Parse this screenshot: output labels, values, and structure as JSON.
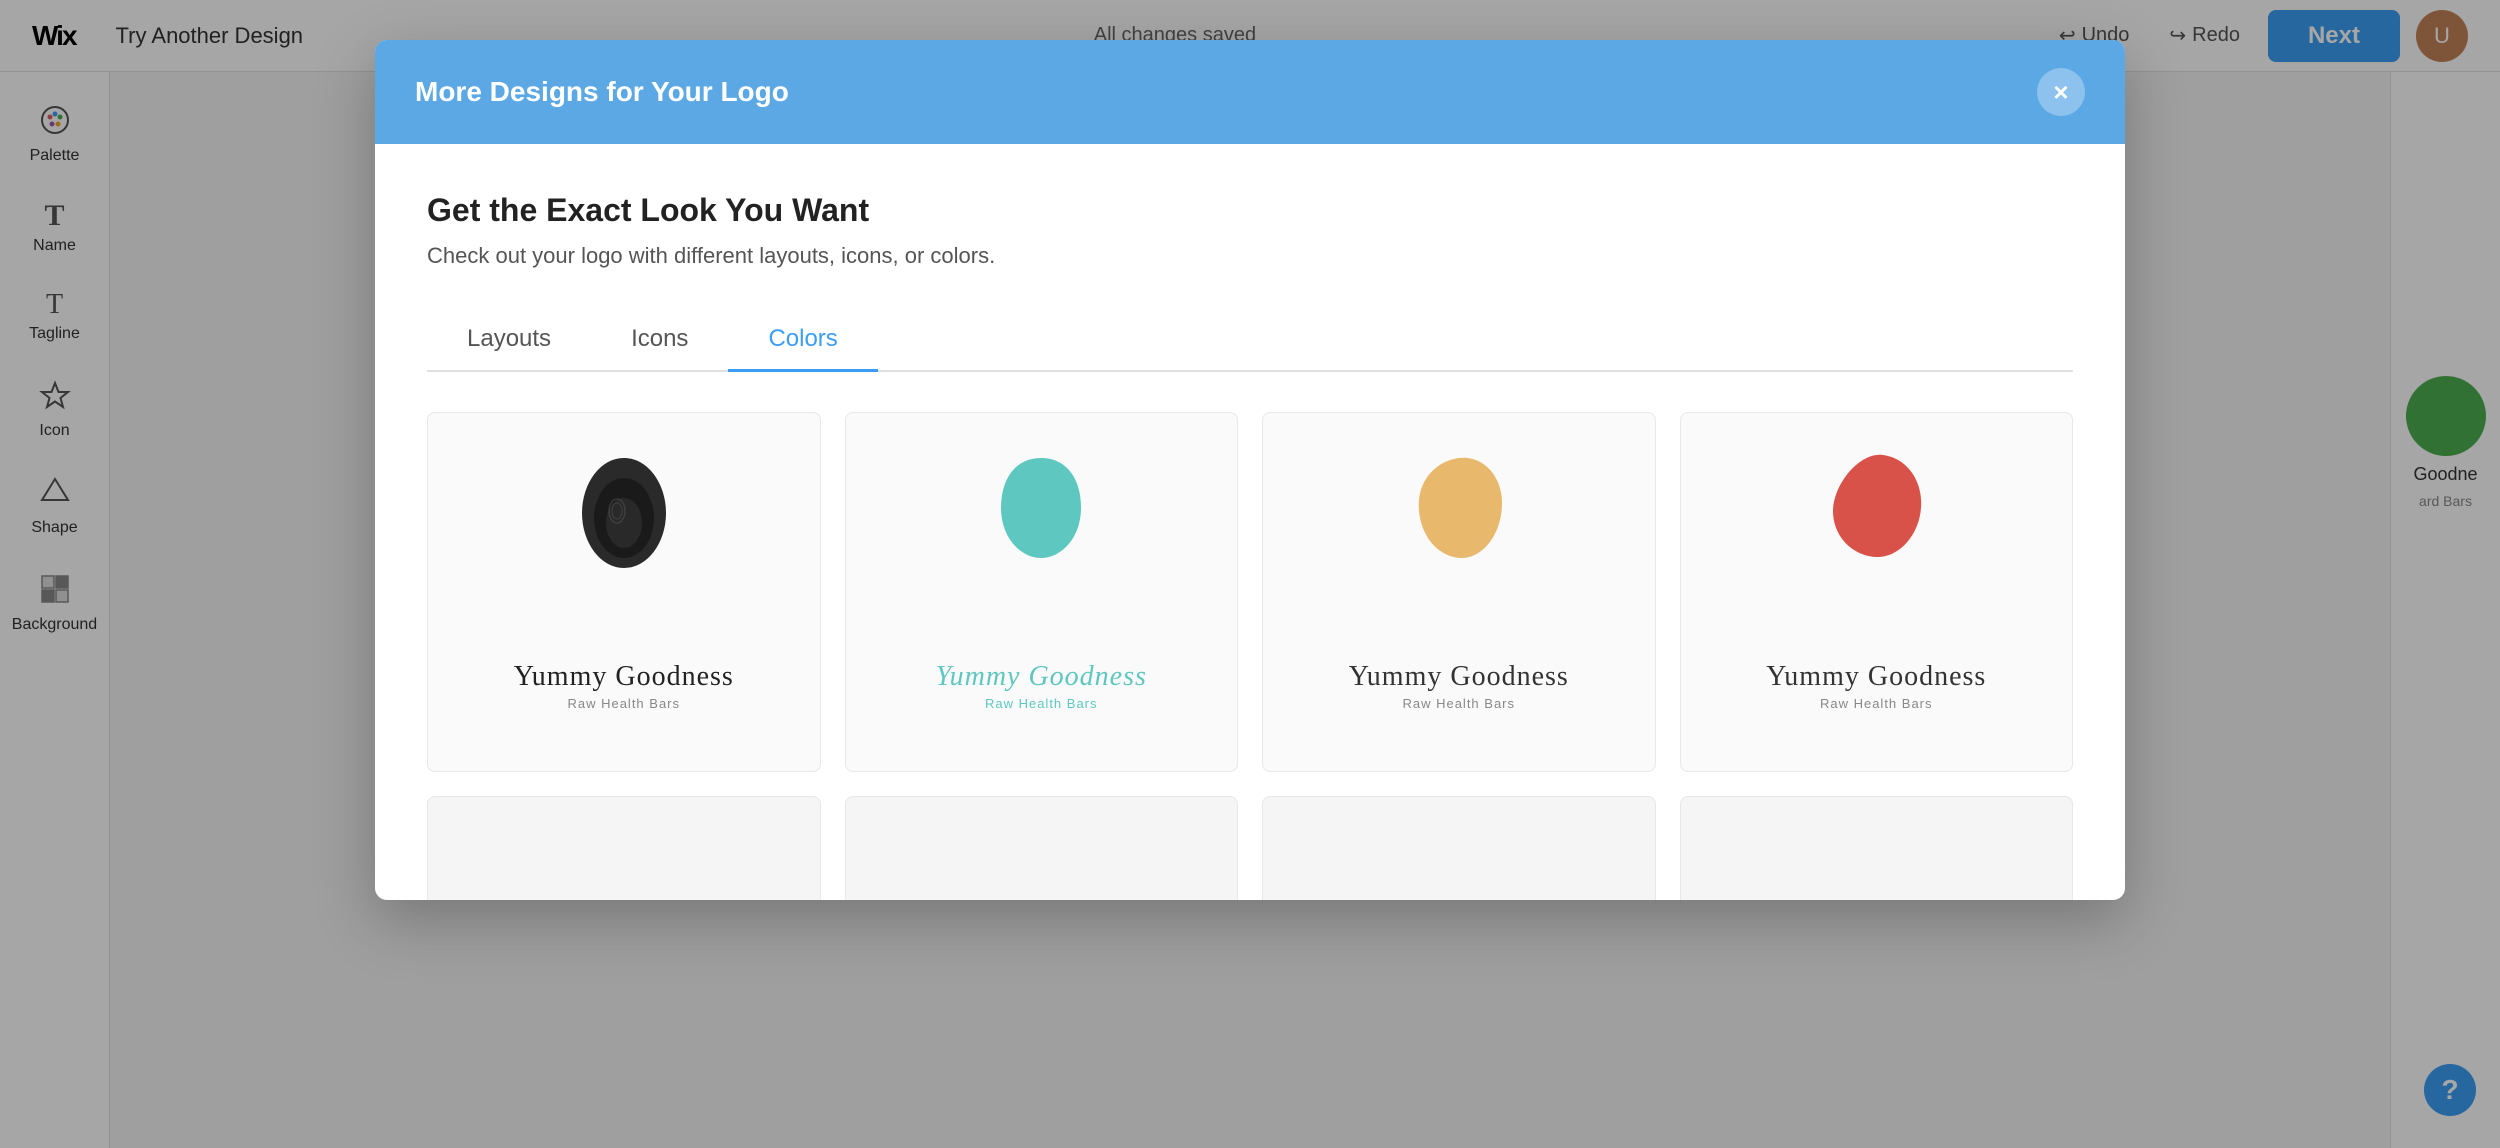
{
  "app": {
    "logo": "Wix",
    "topBar": {
      "tryAnotherDesign": "Try Another Design",
      "changesSaved": "All changes saved",
      "undoLabel": "Undo",
      "redoLabel": "Redo",
      "nextLabel": "Next"
    },
    "sidebar": {
      "items": [
        {
          "id": "palette",
          "label": "Palette",
          "icon": "🎨"
        },
        {
          "id": "name",
          "label": "Name",
          "icon": "T"
        },
        {
          "id": "tagline",
          "label": "Tagline",
          "icon": "T"
        },
        {
          "id": "icon",
          "label": "Icon",
          "icon": "⭐"
        },
        {
          "id": "shape",
          "label": "Shape",
          "icon": "◇"
        },
        {
          "id": "background",
          "label": "Background",
          "icon": "▦"
        }
      ]
    }
  },
  "modal": {
    "title": "More Designs for Your Logo",
    "closeLabel": "×",
    "heading": "Get the Exact Look You Want",
    "subtext": "Check out your logo with different layouts, icons, or colors.",
    "tabs": [
      {
        "id": "layouts",
        "label": "Layouts"
      },
      {
        "id": "icons",
        "label": "Icons"
      },
      {
        "id": "colors",
        "label": "Colors"
      }
    ],
    "activeTab": "colors",
    "logoCards": [
      {
        "id": "card-black",
        "brandName": "Yummy Goodness",
        "tagline": "Raw Health Bars",
        "blobColor": "#222222",
        "brandColor": "#222222",
        "taglineColor": "#888888"
      },
      {
        "id": "card-teal",
        "brandName": "Yummy Goodness",
        "tagline": "Raw Health Bars",
        "blobColor": "#5ec7bf",
        "brandColor": "#5ec7bf",
        "taglineColor": "#5ec7bf"
      },
      {
        "id": "card-yellow",
        "brandName": "Yummy Goodness",
        "tagline": "Raw Health Bars",
        "blobColor": "#e8b86d",
        "brandColor": "#333333",
        "taglineColor": "#888888"
      },
      {
        "id": "card-red",
        "brandName": "Yummy Goodness",
        "tagline": "Raw Health Bars",
        "blobColor": "#d9524a",
        "brandColor": "#333333",
        "taglineColor": "#888888"
      }
    ],
    "emptyCards": [
      "ec1",
      "ec2",
      "ec3",
      "ec4"
    ]
  },
  "helpButton": "?"
}
